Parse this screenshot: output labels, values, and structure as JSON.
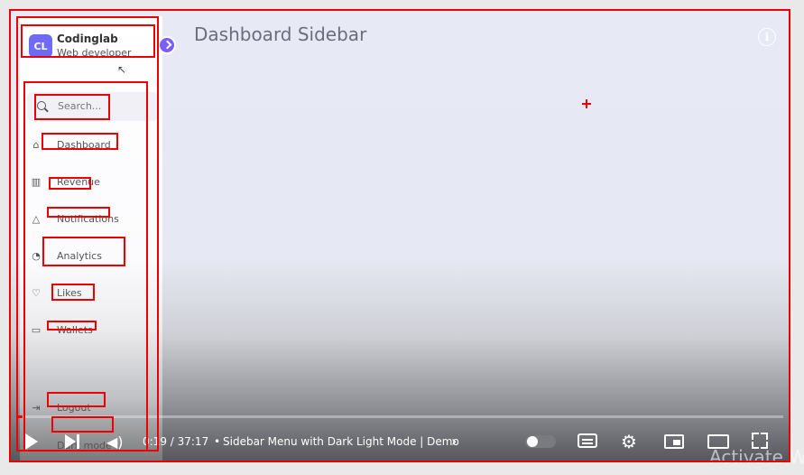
{
  "sidebar": {
    "brand": {
      "logo_text": "CL",
      "name": "Codinglab",
      "role": "Web developer"
    },
    "search": {
      "placeholder": "Search..."
    },
    "items": [
      {
        "label": "Dashboard",
        "icon": "home-icon"
      },
      {
        "label": "Revenue",
        "icon": "bar-chart-icon"
      },
      {
        "label": "Notifications",
        "icon": "bell-icon"
      },
      {
        "label": "Analytics",
        "icon": "pie-chart-icon"
      },
      {
        "label": "Likes",
        "icon": "heart-icon"
      },
      {
        "label": "Wallets",
        "icon": "wallet-icon"
      }
    ],
    "logout": {
      "label": "Logout",
      "icon": "logout-icon"
    },
    "darkmode": {
      "label": "Dark mode"
    }
  },
  "main": {
    "title": "Dashboard Sidebar",
    "info_symbol": "i"
  },
  "player": {
    "time": "0:19 / 37:17",
    "chapter": "Sidebar Menu with Dark Light Mode | Demo",
    "chapter_separator": "•",
    "chapter_chevron": "›",
    "progress_fraction": 0.0085
  },
  "overlay": {
    "watermark": "Activate W"
  },
  "colors": {
    "accent": "#6f6af8",
    "progress": "#ff0000",
    "annotation": "#e00000"
  }
}
